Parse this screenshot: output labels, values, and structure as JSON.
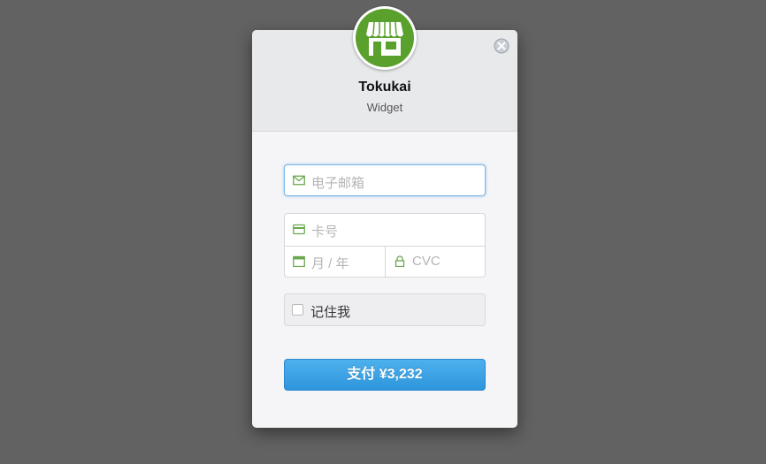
{
  "merchant": {
    "name": "Tokukai",
    "subtitle": "Widget"
  },
  "form": {
    "email_placeholder": "电子邮箱",
    "card_number_placeholder": "卡号",
    "expiry_placeholder": "月 / 年",
    "cvc_placeholder": "CVC",
    "remember_label": "记住我",
    "pay_label": "支付 ¥3,232"
  },
  "icons": {
    "logo": "storefront-icon",
    "close": "close-icon",
    "email": "envelope-icon",
    "card": "credit-card-icon",
    "expiry": "calendar-icon",
    "cvc": "lock-icon"
  },
  "colors": {
    "accent": "#3a9fe3",
    "brand": "#5aa02c",
    "icon_green": "#6aa84f"
  }
}
